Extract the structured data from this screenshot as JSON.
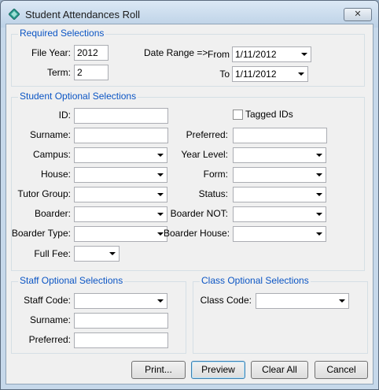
{
  "window": {
    "title": "Student Attendances Roll",
    "close_label": "✕"
  },
  "required": {
    "legend": "Required Selections",
    "file_year_label": "File Year:",
    "file_year_value": "2012",
    "term_label": "Term:",
    "term_value": "2",
    "date_range_label": "Date Range =>",
    "from_label": "From",
    "from_value": "1/11/2012",
    "to_label": "To",
    "to_value": "1/11/2012"
  },
  "student": {
    "legend": "Student Optional Selections",
    "id_label": "ID:",
    "tagged_ids_label": "Tagged IDs",
    "surname_label": "Surname:",
    "preferred_label": "Preferred:",
    "campus_label": "Campus:",
    "year_level_label": "Year Level:",
    "house_label": "House:",
    "form_label": "Form:",
    "tutor_group_label": "Tutor Group:",
    "status_label": "Status:",
    "boarder_label": "Boarder:",
    "boarder_not_label": "Boarder NOT:",
    "boarder_type_label": "Boarder Type:",
    "boarder_house_label": "Boarder House:",
    "full_fee_label": "Full Fee:"
  },
  "staff": {
    "legend": "Staff Optional Selections",
    "staff_code_label": "Staff Code:",
    "surname_label": "Surname:",
    "preferred_label": "Preferred:"
  },
  "class": {
    "legend": "Class Optional Selections",
    "class_code_label": "Class Code:"
  },
  "buttons": {
    "print": "Print...",
    "preview": "Preview",
    "clear_all": "Clear All",
    "cancel": "Cancel"
  },
  "colors": {
    "legend": "#0b55c4",
    "window_frame": "#c6d8ea"
  }
}
